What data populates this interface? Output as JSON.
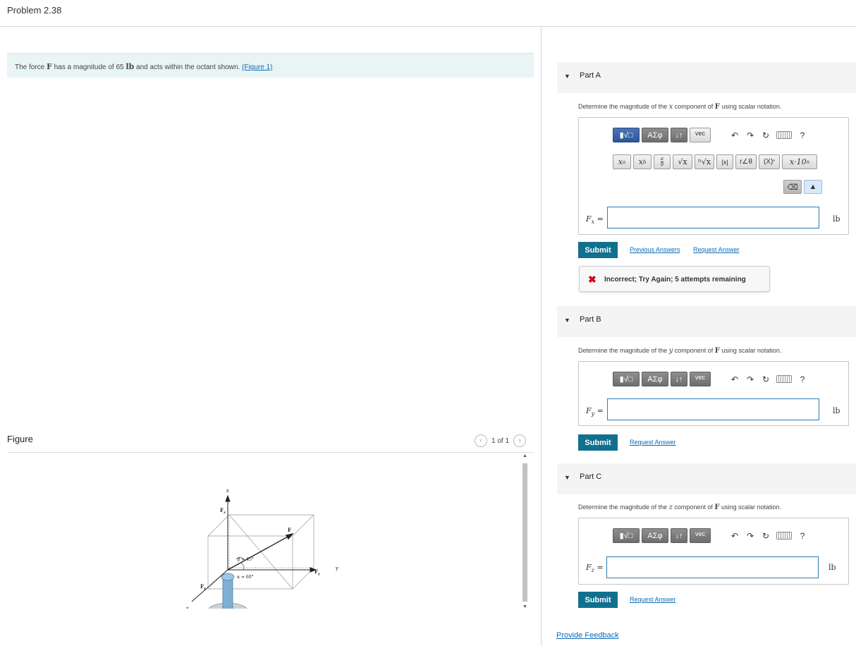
{
  "header": {
    "title": "Problem 2.38"
  },
  "problem": {
    "text_before": "The force ",
    "force_symbol": "F",
    "text_mid": " has a magnitude of 65 ",
    "unit_symbol": "lb",
    "text_after": " and acts within the octant shown. ",
    "figure_link": "(Figure 1)"
  },
  "figure": {
    "label": "Figure",
    "pager": "1 of 1",
    "prev_icon": "chevron-left-icon",
    "next_icon": "chevron-right-icon",
    "labels": {
      "z_axis": "z",
      "y_axis": "y",
      "x_axis": "x",
      "fz": "F",
      "fz_sub": "z",
      "fy": "F",
      "fy_sub": "y",
      "fx": "F",
      "fx_sub": "x",
      "force": "F",
      "beta": "β = 45°",
      "alpha": "α = 60°"
    }
  },
  "toolbar": {
    "templates": "▮√□",
    "greek": "ΑΣφ",
    "arrows": "↓↑",
    "vec": "vec",
    "undo_icon": "undo-icon",
    "redo_icon": "redo-icon",
    "reset_icon": "reset-icon",
    "keyboard_icon": "keyboard-icon",
    "help": "?",
    "row2": [
      "xᵃ",
      "x_b",
      "a/b",
      "√x",
      "ⁿ√x",
      "|x|",
      "r∠θ",
      "(X)*",
      "x·10ⁿ"
    ],
    "row2_labels": {
      "pow": "x",
      "pow_sup": "a",
      "sub": "x",
      "sub_sub": "b",
      "frac_top": "a",
      "frac_bot": "b",
      "sqrt": "√x",
      "nroot": "ⁿ√x",
      "abs": "|x|",
      "polar": "r∠θ",
      "conj": "(X)",
      "conj_sup": "*",
      "sci": "x·10",
      "sci_sup": "n"
    }
  },
  "parts": [
    {
      "label": "Part A",
      "question_before": "Determine the magnitude of the ",
      "axis": "x",
      "question_mid": " component of ",
      "force": "F",
      "question_after": " using scalar notation.",
      "eq_var": "F",
      "eq_sub": "x",
      "eq_sign": " =",
      "unit": "lb",
      "submit": "Submit",
      "previous_answers": "Previous Answers",
      "request_answer": "Request Answer",
      "feedback": "Incorrect; Try Again; 5 attempts remaining"
    },
    {
      "label": "Part B",
      "question_before": "Determine the magnitude of the ",
      "axis": "y",
      "question_mid": " component of ",
      "force": "F",
      "question_after": " using scalar notation.",
      "eq_var": "F",
      "eq_sub": "y",
      "eq_sign": " =",
      "unit": "lb",
      "submit": "Submit",
      "request_answer": "Request Answer"
    },
    {
      "label": "Part C",
      "question_before": "Determine the magnitude of the ",
      "axis": "z",
      "question_mid": " component of ",
      "force": "F",
      "question_after": " using scalar notation.",
      "eq_var": "F",
      "eq_sub": "z",
      "eq_sign": " =",
      "unit": "lb",
      "submit": "Submit",
      "request_answer": "Request Answer"
    }
  ],
  "footer": {
    "provide_feedback": "Provide Feedback"
  },
  "colors": {
    "submit": "#12708f",
    "link": "#0a6cb5",
    "error": "#d0021b",
    "input_border": "#2a7db5",
    "problem_bg": "#e9f4f4"
  }
}
